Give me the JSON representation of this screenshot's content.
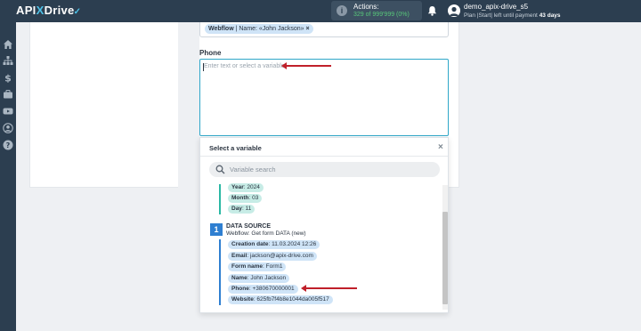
{
  "header": {
    "logo_text": "API",
    "logo_x": "X",
    "logo_rest": "Drive",
    "actions_label": "Actions:",
    "actions_count": "329 of 999'999 (0%)",
    "user_name": "demo_apix-drive_s5",
    "plan_text": "Plan |Start| left until payment",
    "plan_days": "43 days"
  },
  "sidebar": {
    "icons": [
      "home-icon",
      "sitemap-icon",
      "dollar-icon",
      "briefcase-icon",
      "youtube-icon",
      "user-icon",
      "help-icon"
    ]
  },
  "name_field": {
    "tag_source": "Webflow",
    "tag_rest": " | Name: «John Jackson»",
    "tag_remove": "×"
  },
  "phone": {
    "label": "Phone",
    "placeholder": "Enter text or select a variable"
  },
  "dropdown": {
    "title": "Select a variable",
    "close": "×",
    "search_placeholder": "Variable search",
    "date_vars": [
      {
        "key": "Year",
        "value": ": 2024"
      },
      {
        "key": "Month",
        "value": ": 03"
      },
      {
        "key": "Day",
        "value": ": 11"
      }
    ],
    "source": {
      "number": "1",
      "title": "DATA SOURCE",
      "subtitle": "Webflow: Get form DATA (new)"
    },
    "source_vars": [
      {
        "key": "Creation date",
        "value": ": 11.03.2024 12:26"
      },
      {
        "key": "Email",
        "value": ": jackson@apix-drive.com"
      },
      {
        "key": "Form name",
        "value": ": Form1"
      },
      {
        "key": "Name",
        "value": ": John Jackson"
      },
      {
        "key": "Phone",
        "value": ": +380670000001"
      },
      {
        "key": "Website",
        "value": ": 625fb7f4b8e1044da005f517"
      }
    ]
  },
  "colors": {
    "topbar": "#2c3e50",
    "accent": "#2fa7c9",
    "arrow": "#c0202a",
    "chip_teal": "#c7ece6",
    "chip_blue": "#cfe4f7",
    "source_badge": "#2f7fd1"
  }
}
